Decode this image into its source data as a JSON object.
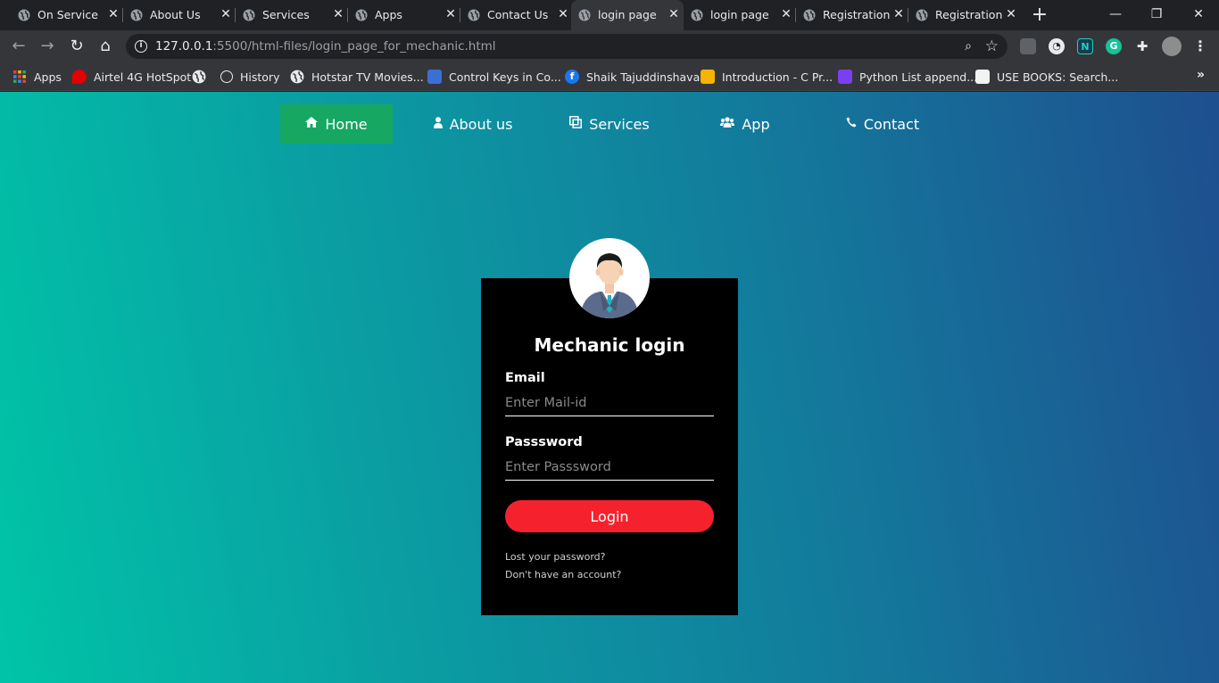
{
  "browser": {
    "tabs": [
      {
        "title": "On Service",
        "active": false
      },
      {
        "title": "About Us",
        "active": false
      },
      {
        "title": "Services",
        "active": false
      },
      {
        "title": "Apps",
        "active": false
      },
      {
        "title": "Contact Us",
        "active": false
      },
      {
        "title": "login page",
        "active": true
      },
      {
        "title": "login page",
        "active": false
      },
      {
        "title": "Registration",
        "active": false
      },
      {
        "title": "Registration",
        "active": false
      }
    ],
    "url_host": "127.0.0.1",
    "url_rest": ":5500/html-files/login_page_for_mechanic.html",
    "bookmarks": [
      {
        "label": "Apps",
        "icon": "apps-grid-icon"
      },
      {
        "label": "Airtel 4G HotSpot",
        "icon": "airtel-icon"
      },
      {
        "label": "",
        "icon": "globe-icon"
      },
      {
        "label": "History",
        "icon": "history-icon"
      },
      {
        "label": "Hotstar TV Movies...",
        "icon": "globe-icon"
      },
      {
        "label": "Control Keys in Co...",
        "icon": "site-icon"
      },
      {
        "label": "Shaik Tajuddinshavali",
        "icon": "facebook-icon"
      },
      {
        "label": "Introduction - C Pr...",
        "icon": "site-icon"
      },
      {
        "label": "Python List append...",
        "icon": "site-icon"
      },
      {
        "label": "USE BOOKS: Search...",
        "icon": "site-icon"
      }
    ]
  },
  "nav": {
    "items": [
      {
        "label": "Home",
        "icon": "home-icon",
        "active": true
      },
      {
        "label": "About us",
        "icon": "user-icon",
        "active": false
      },
      {
        "label": "Services",
        "icon": "clone-icon",
        "active": false
      },
      {
        "label": "App",
        "icon": "users-icon",
        "active": false
      },
      {
        "label": "Contact",
        "icon": "phone-icon",
        "active": false
      }
    ]
  },
  "login": {
    "title": "Mechanic login",
    "email_label": "Email",
    "email_placeholder": "Enter Mail-id",
    "password_label": "Passsword",
    "password_placeholder": "Enter Passsword",
    "button_label": "Login",
    "lost_password": "Lost your password?",
    "no_account": "Don't have an account?"
  },
  "colors": {
    "nav_active": "#16a862",
    "login_button": "#f5222d",
    "card_bg": "#000000",
    "gradient_start": "#00c4a7",
    "gradient_end": "#1e4f8f"
  }
}
